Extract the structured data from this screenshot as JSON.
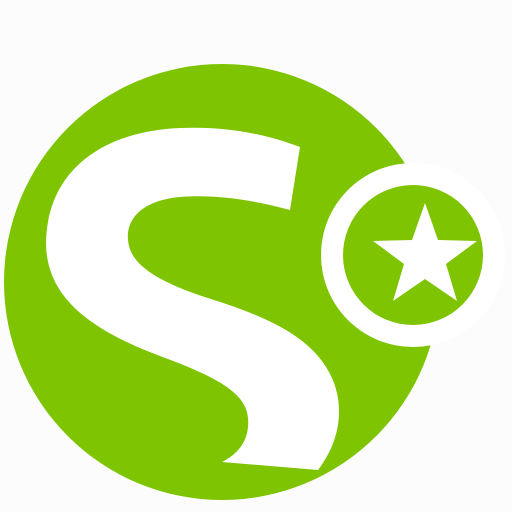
{
  "logo": {
    "name": "s-star-app-logo",
    "colors": {
      "background": "#fcfcfc",
      "primary_green": "#7ec400",
      "letter_white": "#ffffff",
      "badge_ring": "#ffffff",
      "star_white": "#ffffff"
    },
    "glyph": "s-letter",
    "badge_icon": "star-icon"
  }
}
